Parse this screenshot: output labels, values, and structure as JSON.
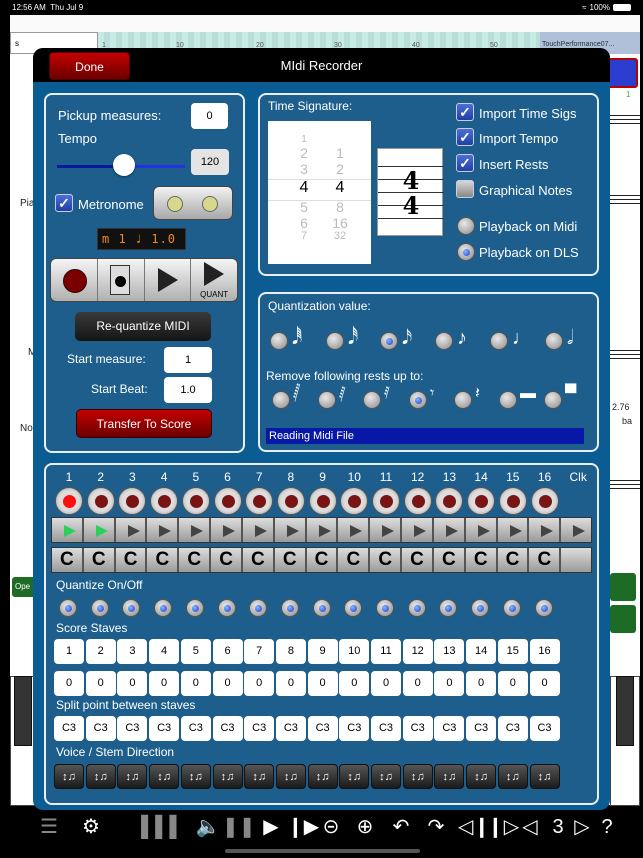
{
  "status_bar": {
    "time": "12:56 AM",
    "date": "Thu Jul 9",
    "wifi": "wifi-icon",
    "battery": "100%"
  },
  "background": {
    "box_text": "s",
    "ruler_ticks": [
      "1",
      "10",
      "20",
      "30",
      "40",
      "50"
    ],
    "file_title": "TouchPerformance07...",
    "labels": [
      "Pia",
      "M",
      "No"
    ],
    "open_button": "Ope",
    "right_value": "2.76",
    "right_text": "ba",
    "measure_num": "1"
  },
  "modal": {
    "title": "MIdi Recorder",
    "done_label": "Done"
  },
  "left_panel": {
    "pickup_label": "Pickup measures:",
    "pickup_value": "0",
    "tempo_label": "Tempo",
    "tempo_value": "120",
    "tempo_fraction": 0.5,
    "metronome_label": "Metronome",
    "metronome_checked": true,
    "lcd_text": "m   1 ♩  1.0",
    "transport": {
      "record": "record-icon",
      "midi_file": "midi-file-icon",
      "play": "play-icon",
      "quant_play": "QUANT"
    },
    "requantize_label": "Re-quantize MIDI",
    "start_measure_label": "Start measure:",
    "start_measure_value": "1",
    "start_beat_label": "Start Beat:",
    "start_beat_value": "1.0",
    "transfer_label": "Transfer To Score"
  },
  "time_sig_panel": {
    "label": "Time Signature:",
    "numerators": [
      "1",
      "2",
      "3",
      "4",
      "5",
      "6",
      "7"
    ],
    "denominators": [
      "",
      "1",
      "2",
      "4",
      "8",
      "16",
      "32"
    ],
    "selected_numerator": "4",
    "selected_denominator": "4",
    "preview_top": "4",
    "preview_bottom": "4",
    "options": [
      {
        "label": "Import Time Sigs",
        "checked": true
      },
      {
        "label": "Import Tempo",
        "checked": true
      },
      {
        "label": "Insert Rests",
        "checked": true
      },
      {
        "label": "Graphical Notes",
        "checked": false
      }
    ],
    "playback": [
      {
        "label": "Playback on Midi",
        "selected": false
      },
      {
        "label": "Playback on DLS",
        "selected": true
      }
    ]
  },
  "quant_panel": {
    "label": "Quantization value:",
    "values": [
      {
        "note": "64th",
        "glyph": "𝅘𝅥𝅱",
        "selected": false
      },
      {
        "note": "32nd",
        "glyph": "𝅘𝅥𝅰",
        "selected": false
      },
      {
        "note": "16th",
        "glyph": "𝅘𝅥𝅯",
        "selected": true
      },
      {
        "note": "8th",
        "glyph": "♪",
        "selected": false
      },
      {
        "note": "quarter",
        "glyph": "♩",
        "selected": false
      },
      {
        "note": "half",
        "glyph": "𝅗𝅥",
        "selected": false
      }
    ],
    "rests_label": "Remove following rests up to:",
    "rests": [
      {
        "rest": "64th",
        "glyph": "𝅂",
        "selected": false
      },
      {
        "rest": "32nd",
        "glyph": "𝅁",
        "selected": false
      },
      {
        "rest": "16th",
        "glyph": "𝅀",
        "selected": false
      },
      {
        "rest": "8th",
        "glyph": "𝄾",
        "selected": true
      },
      {
        "rest": "quarter",
        "glyph": "𝄽",
        "selected": false
      },
      {
        "rest": "half",
        "glyph": "▬",
        "selected": false
      },
      {
        "rest": "whole",
        "glyph": "▀",
        "selected": false
      }
    ],
    "status": "Reading Midi File"
  },
  "channels": {
    "numbers": [
      "1",
      "2",
      "3",
      "4",
      "5",
      "6",
      "7",
      "8",
      "9",
      "10",
      "11",
      "12",
      "13",
      "14",
      "15",
      "16"
    ],
    "clock_label": "Clk",
    "record_active": [
      true,
      false,
      false,
      false,
      false,
      false,
      false,
      false,
      false,
      false,
      false,
      false,
      false,
      false,
      false,
      false
    ],
    "play_active": [
      true,
      true,
      false,
      false,
      false,
      false,
      false,
      false,
      false,
      false,
      false,
      false,
      false,
      false,
      false,
      false,
      false
    ],
    "clef_labels": [
      "C",
      "C",
      "C",
      "C",
      "C",
      "C",
      "C",
      "C",
      "C",
      "C",
      "C",
      "C",
      "C",
      "C",
      "C",
      "C",
      ""
    ],
    "quantize_label": "Quantize On/Off",
    "quantize_on": [
      true,
      true,
      true,
      true,
      true,
      true,
      true,
      true,
      true,
      true,
      true,
      true,
      true,
      true,
      true,
      true
    ],
    "score_staves_label": "Score Staves",
    "staves": [
      "1",
      "2",
      "3",
      "4",
      "5",
      "6",
      "7",
      "8",
      "9",
      "10",
      "11",
      "12",
      "13",
      "14",
      "15",
      "16"
    ],
    "staves2": [
      "0",
      "0",
      "0",
      "0",
      "0",
      "0",
      "0",
      "0",
      "0",
      "0",
      "0",
      "0",
      "0",
      "0",
      "0",
      "0"
    ],
    "split_label": "Split point between staves",
    "splits": [
      "C3",
      "C3",
      "C3",
      "C3",
      "C3",
      "C3",
      "C3",
      "C3",
      "C3",
      "C3",
      "C3",
      "C3",
      "C3",
      "C3",
      "C3",
      "C3"
    ],
    "voice_label": "Voice / Stem Direction",
    "voice_icon": "↕♫"
  },
  "toolbar": [
    {
      "name": "document-icon",
      "glyph": "☰"
    },
    {
      "name": "gear-icon",
      "glyph": "⚙"
    },
    {
      "name": "piano-keyboard-icon",
      "glyph": "▐▐▐"
    },
    {
      "name": "speaker-icon",
      "glyph": "🔈"
    },
    {
      "name": "pause-icon",
      "glyph": "❚❚"
    },
    {
      "name": "play-icon",
      "glyph": "▶"
    },
    {
      "name": "play-from-cursor-icon",
      "glyph": "❙▶"
    },
    {
      "name": "zoom-out-icon",
      "glyph": "⊝"
    },
    {
      "name": "zoom-in-icon",
      "glyph": "⊕"
    },
    {
      "name": "undo-icon",
      "glyph": "↶"
    },
    {
      "name": "redo-icon",
      "glyph": "↷"
    },
    {
      "name": "insert-measure-left-icon",
      "glyph": "◁❙"
    },
    {
      "name": "insert-measure-right-icon",
      "glyph": "❙▷"
    },
    {
      "name": "previous-page-icon",
      "glyph": "◁"
    },
    {
      "name": "page-number",
      "glyph": "3"
    },
    {
      "name": "next-page-icon",
      "glyph": "▷"
    },
    {
      "name": "help-icon",
      "glyph": "?"
    }
  ]
}
